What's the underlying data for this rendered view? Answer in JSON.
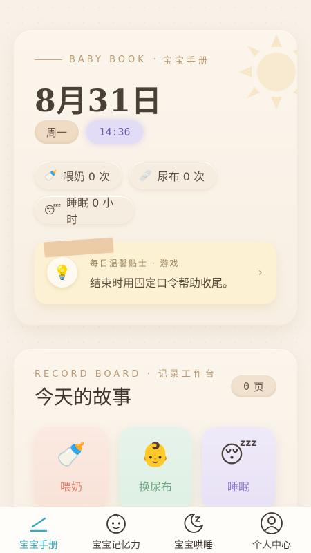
{
  "header": {
    "eyebrow_en": "BABY BOOK",
    "eyebrow_sep": "·",
    "eyebrow_cn": "宝宝手册",
    "date": "8月31日",
    "weekday": "周一",
    "time": "14:36"
  },
  "stats": {
    "feed": {
      "icon": "🍼",
      "label": "喂奶 0 次"
    },
    "diaper": {
      "icon": "🩹",
      "label": "尿布 0 次"
    },
    "sleep": {
      "icon": "😴",
      "label": "睡眠 0 小时"
    }
  },
  "tip": {
    "icon": "💡",
    "subtitle": "每日温馨贴士 · 游戏",
    "text": "结束时用固定口令帮助收尾。",
    "arrow": "›"
  },
  "board": {
    "eyebrow": "RECORD BOARD · 记录工作台",
    "title": "今天的故事",
    "page_count": "0",
    "page_unit": "页",
    "actions": [
      {
        "emoji": "🍼",
        "label": "喂奶"
      },
      {
        "emoji": "👶",
        "label": "换尿布"
      },
      {
        "emoji": "😴",
        "label": "睡眠"
      }
    ]
  },
  "tabbar": {
    "active_color": "#3aa9bc",
    "tabs": [
      {
        "label": "宝宝手册",
        "icon": "pen-icon"
      },
      {
        "label": "宝宝记忆力",
        "icon": "baby-face-icon"
      },
      {
        "label": "宝宝哄睡",
        "icon": "moon-sleep-icon"
      },
      {
        "label": "个人中心",
        "icon": "user-icon"
      }
    ]
  }
}
